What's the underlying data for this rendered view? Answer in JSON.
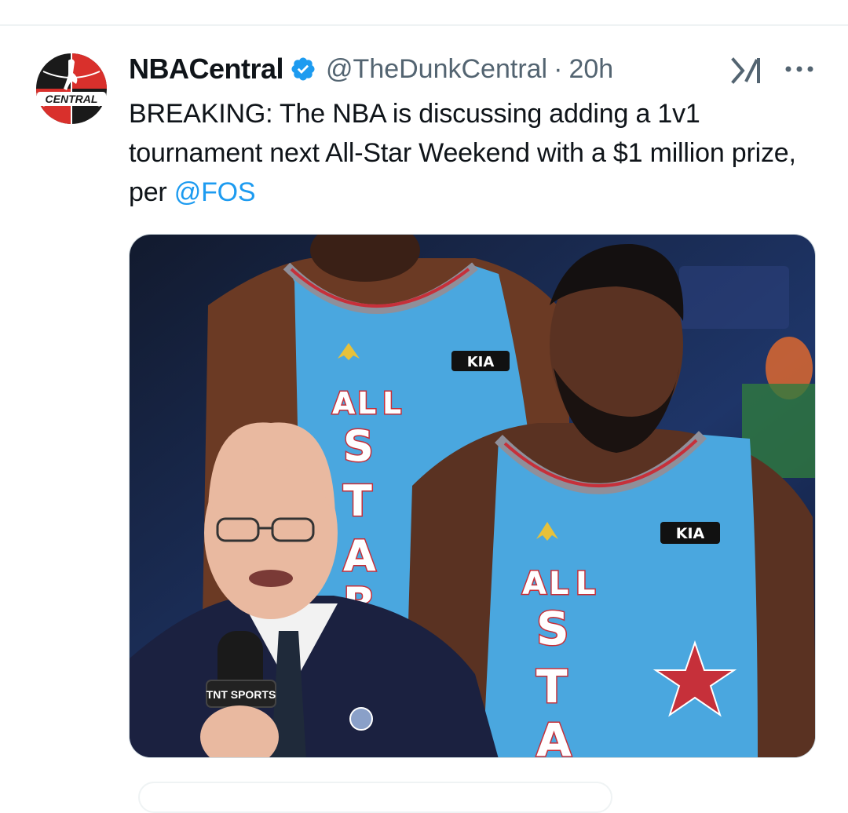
{
  "tweet": {
    "author": {
      "display_name": "NBACentral",
      "handle": "@TheDunkCentral",
      "verified": true,
      "avatar_text": "CENTRAL"
    },
    "separator": "·",
    "timestamp": "20h",
    "text_parts": {
      "before_mention": "BREAKING: The NBA is discussing adding a 1v1 tournament next All-Star Weekend with a $1 million prize, per ",
      "mention": "@FOS"
    },
    "media": {
      "jersey_brand": "KIA",
      "jersey_letters_left": [
        "A",
        "L",
        "L",
        "S",
        "T",
        "A",
        "R"
      ],
      "jersey_letters_right": [
        "A",
        "L",
        "L",
        "S",
        "T",
        "A"
      ],
      "mic_flag": "TNT SPORTS"
    },
    "icons": {
      "verified": "verified-badge-icon",
      "grok": "grok-icon",
      "more": "more-icon"
    },
    "colors": {
      "link": "#1d9bf0",
      "verified": "#1d9bf0",
      "secondary_text": "#536471",
      "jersey": "#4aa7df"
    }
  }
}
